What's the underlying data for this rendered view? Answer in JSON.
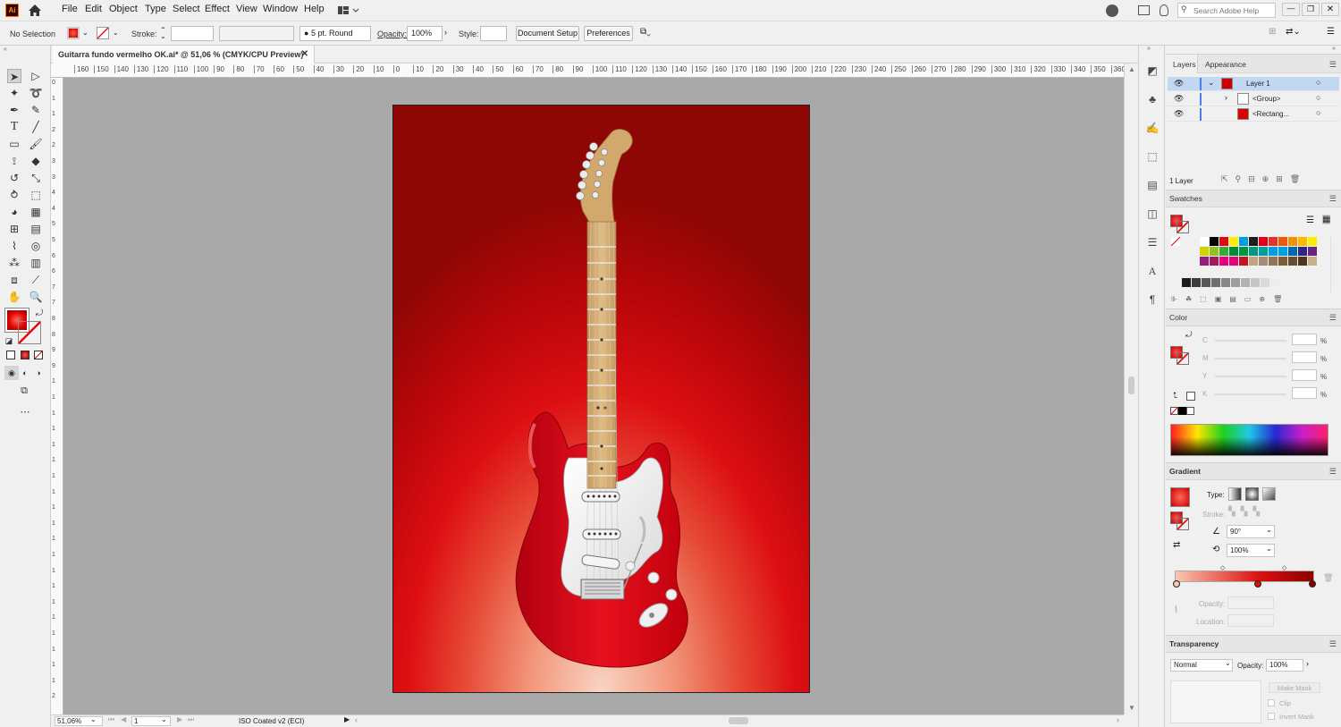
{
  "app": {
    "logo": "Ai"
  },
  "menu": [
    "File",
    "Edit",
    "Object",
    "Type",
    "Select",
    "Effect",
    "View",
    "Window",
    "Help"
  ],
  "search": {
    "placeholder": "Search Adobe Help"
  },
  "control_bar": {
    "selection": "No Selection",
    "stroke_label": "Stroke:",
    "brush": "5 pt. Round",
    "opacity_label": "Opacity:",
    "opacity_value": "100%",
    "style_label": "Style:",
    "document_setup": "Document Setup",
    "preferences": "Preferences"
  },
  "document": {
    "tab_title": "Guitarra fundo vermelho OK.ai* @ 51,06 % (CMYK/CPU Preview)"
  },
  "ruler": {
    "h_ticks": [
      "160",
      "150",
      "140",
      "130",
      "120",
      "110",
      "100",
      "90",
      "80",
      "70",
      "60",
      "50",
      "40",
      "30",
      "20",
      "10",
      "0",
      "10",
      "20",
      "30",
      "40",
      "50",
      "60",
      "70",
      "80",
      "90",
      "100",
      "110",
      "120",
      "130",
      "140",
      "150",
      "160",
      "170",
      "180",
      "190",
      "200",
      "210",
      "220",
      "230",
      "240",
      "250",
      "260",
      "270",
      "280",
      "290",
      "300",
      "310",
      "320",
      "330",
      "340",
      "350",
      "360"
    ],
    "v_ticks": [
      "0",
      "1",
      "1",
      "2",
      "2",
      "3",
      "3",
      "4",
      "4",
      "5",
      "5",
      "6",
      "6",
      "7",
      "7",
      "8",
      "8",
      "9",
      "9",
      "1",
      "1",
      "1",
      "1",
      "1",
      "1",
      "1",
      "1",
      "1",
      "1",
      "1",
      "1",
      "1",
      "1",
      "1",
      "1",
      "1",
      "1",
      "1",
      "1",
      "2"
    ]
  },
  "status": {
    "zoom": "51,06%",
    "artboard": "1",
    "profile": "ISO Coated v2 (ECI)"
  },
  "layers_panel": {
    "tabs": [
      "Layers",
      "Appearance"
    ],
    "rows": [
      {
        "name": "Layer 1"
      },
      {
        "name": "<Group>"
      },
      {
        "name": "<Rectang..."
      }
    ],
    "footer": "1 Layer"
  },
  "swatches_panel": {
    "title": "Swatches",
    "colors_row1": [
      "#ffffff",
      "#000000",
      "#e30613",
      "#ffed00",
      "#009fe3",
      "#1d1d1b",
      "#e2001a",
      "#e6332a",
      "#ea5b0c",
      "#f39200",
      "#fbba00",
      "#ffed00"
    ],
    "colors_row2": [
      "#d2d200",
      "#95c11f",
      "#3aaa35",
      "#008d36",
      "#00963f",
      "#009982",
      "#00a19a",
      "#00a0e2",
      "#009fe3",
      "#0069b4",
      "#312783",
      "#662483"
    ],
    "colors_row3": [
      "#951b81",
      "#a3195b",
      "#e6007e",
      "#e5007d",
      "#be1622",
      "#c6a47b",
      "#a48a7b",
      "#947459",
      "#7d5c3c",
      "#6b4c2e",
      "#4d3520",
      "#c9ae8a"
    ],
    "grays": [
      "#1d1d1b",
      "#3c3c3b",
      "#575756",
      "#706f6f",
      "#878787",
      "#9d9d9c",
      "#b2b2b2",
      "#c6c6c5",
      "#dadada",
      "#ededed"
    ]
  },
  "color_panel": {
    "title": "Color",
    "channels": [
      {
        "label": "C"
      },
      {
        "label": "M"
      },
      {
        "label": "Y"
      },
      {
        "label": "K"
      }
    ],
    "unit": "%"
  },
  "gradient_panel": {
    "title": "Gradient",
    "type_label": "Type:",
    "stroke_label": "Stroke:",
    "angle": "90°",
    "aspect": "100%",
    "opacity_label": "Opacity:",
    "location_label": "Location:",
    "stops": [
      "#f8c8b0",
      "#dd1010",
      "#8e0000"
    ]
  },
  "transparency_panel": {
    "title": "Transparency",
    "blend_mode": "Normal",
    "opacity_label": "Opacity:",
    "opacity_value": "100%",
    "make_mask": "Make Mask",
    "clip": "Clip",
    "invert_mask": "Invert Mask"
  },
  "accent": {
    "selection_blue": "#c2d8f2",
    "layer_color": "#4a7ef0"
  }
}
